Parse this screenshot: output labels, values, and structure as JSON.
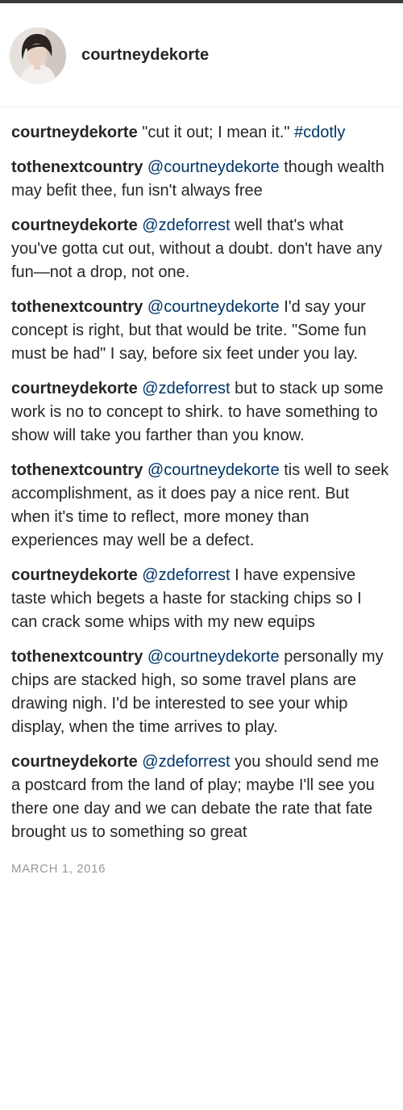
{
  "header": {
    "username": "courtneydekorte"
  },
  "comments": [
    {
      "user": "courtneydekorte",
      "mention": "",
      "text": " \"cut it out; I mean it.\" ",
      "hashtag": "#cdotly"
    },
    {
      "user": "tothenextcountry",
      "mention": "@courtneydekorte",
      "text": " though wealth may befit thee, fun isn't always free"
    },
    {
      "user": "courtneydekorte",
      "mention": "@zdeforrest",
      "text": " well that's what you've gotta cut out, without a doubt. don't have any fun—not a drop, not one."
    },
    {
      "user": "tothenextcountry",
      "mention": "@courtneydekorte",
      "text": " I'd say your concept is right, but that would be trite. \"Some fun must be had\" I say, before six feet under you lay."
    },
    {
      "user": "courtneydekorte",
      "mention": "@zdeforrest",
      "text": " but to stack up some work is no to concept to shirk. to have something to show will take you farther than you know."
    },
    {
      "user": "tothenextcountry",
      "mention": "@courtneydekorte",
      "text": " tis well to seek accomplishment, as it does pay a nice rent. But when it's time to reflect, more money than experiences may well be a defect."
    },
    {
      "user": "courtneydekorte",
      "mention": "@zdeforrest",
      "text": " I have expensive taste which begets a haste for stacking chips so I can crack some whips with my new equips"
    },
    {
      "user": "tothenextcountry",
      "mention": "@courtneydekorte",
      "text": " personally my chips are stacked high, so some travel plans are drawing nigh. I'd be interested to see your whip display, when the time arrives to play."
    },
    {
      "user": "courtneydekorte",
      "mention": "@zdeforrest",
      "text": " you should send me a postcard from the land of play; maybe I'll see you there one day and we can debate the rate that fate brought us to something so great"
    }
  ],
  "timestamp": "MARCH 1, 2016",
  "colors": {
    "mention": "#003569",
    "text": "#262626",
    "timestamp": "#999999"
  }
}
